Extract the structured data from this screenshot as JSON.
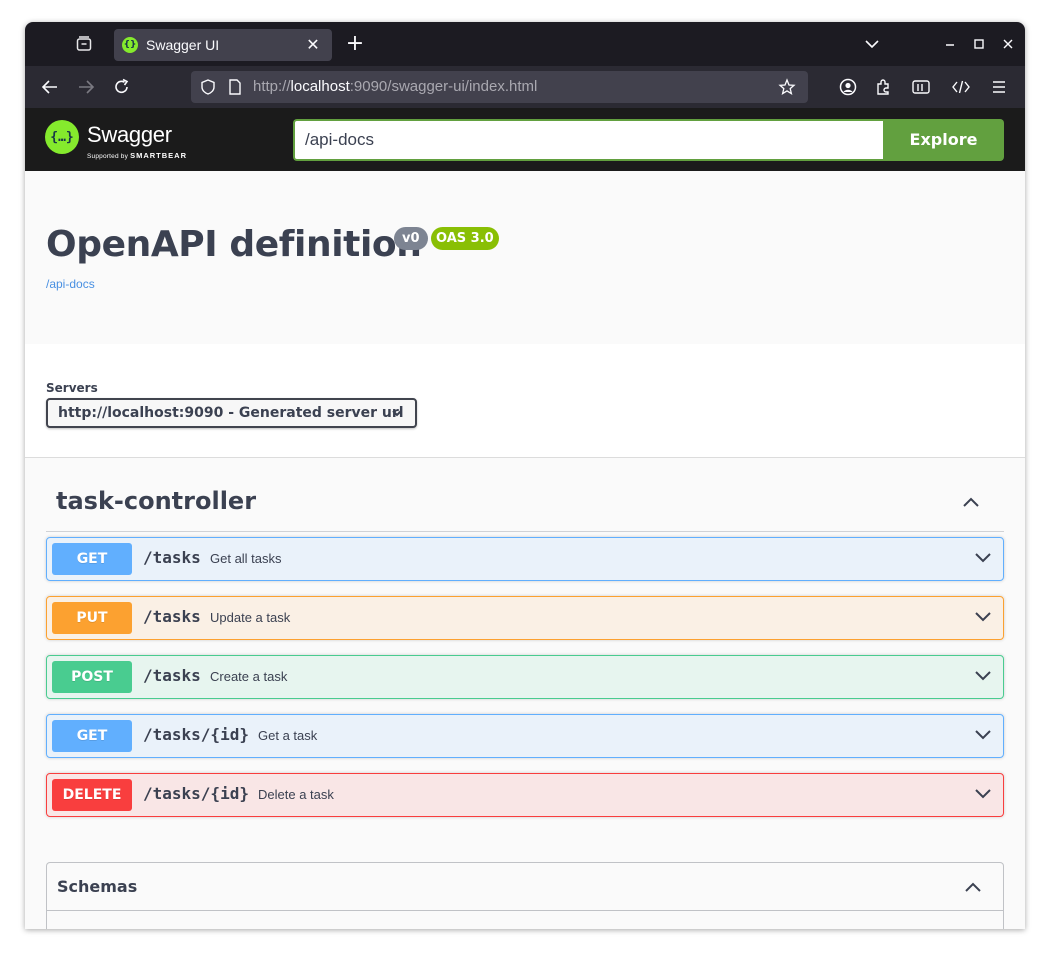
{
  "browser": {
    "tab_title": "Swagger UI",
    "url_prefix": "http://",
    "url_host": "localhost",
    "url_rest": ":9090/swagger-ui/index.html"
  },
  "topbar": {
    "logo_text": "Swagger",
    "logo_sub_prefix": "Supported by",
    "logo_sub_brand": "SMARTBEAR",
    "url_value": "/api-docs",
    "explore_label": "Explore"
  },
  "info": {
    "title": "OpenAPI definition",
    "version_badge": "v0",
    "oas_badge": "OAS 3.0",
    "link": "/api-docs"
  },
  "servers": {
    "label": "Servers",
    "selected": "http://localhost:9090 - Generated server url"
  },
  "tag": {
    "name": "task-controller",
    "operations": [
      {
        "method": "GET",
        "path": "/tasks",
        "summary": "Get all tasks"
      },
      {
        "method": "PUT",
        "path": "/tasks",
        "summary": "Update a task"
      },
      {
        "method": "POST",
        "path": "/tasks",
        "summary": "Create a task"
      },
      {
        "method": "GET",
        "path": "/tasks/{id}",
        "summary": "Get a task"
      },
      {
        "method": "DELETE",
        "path": "/tasks/{id}",
        "summary": "Delete a task"
      }
    ]
  },
  "schemas": {
    "title": "Schemas"
  },
  "colors": {
    "get": "#61affe",
    "put": "#fca130",
    "post": "#49cc90",
    "delete": "#f93e3e",
    "explore": "#62a03f",
    "oas_badge": "#89bf04"
  }
}
